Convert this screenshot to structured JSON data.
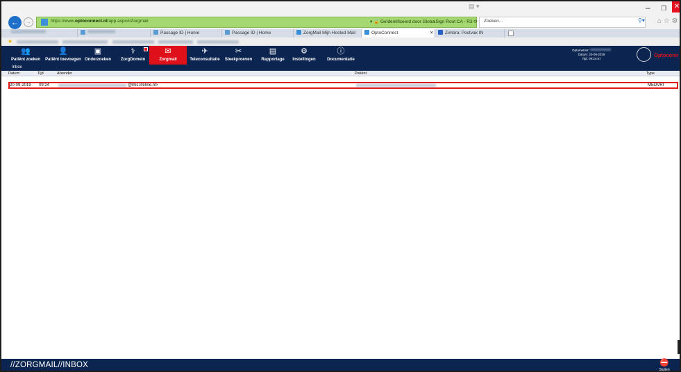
{
  "browser": {
    "window_controls": {
      "minimize": "–",
      "maximize": "❐",
      "close": "✕"
    },
    "address_bar": {
      "url_prefix": "https://www.",
      "url_host": "optoconnect.nl",
      "url_path": "/app.aspx#/Zorgmail",
      "cert_text": "▾ 🔒 Geïdentificeerd door GlobalSign Root CA - R3 ⟳"
    },
    "search": {
      "placeholder": "Zoeken..."
    },
    "tabs": [
      {
        "label": "Passage ID | Home",
        "icon_color": "#5a9bd4"
      },
      {
        "label": "Passage ID | Home",
        "icon_color": "#5a9bd4"
      },
      {
        "label": "ZorgMail Mijn Hosted Mail",
        "icon_color": "#3a8fd9"
      },
      {
        "label": "OptoConnect",
        "icon_color": "#3a8fd9",
        "active": true
      },
      {
        "label": "Zimbra: Postvak IN",
        "icon_color": "#2560c4"
      }
    ],
    "tab_close": "✕"
  },
  "app": {
    "nav": [
      {
        "label": "Patiënt zoeken",
        "icon": "patient-search-icon"
      },
      {
        "label": "Patiënt toevoegen",
        "icon": "patient-add-icon"
      },
      {
        "label": "Onderzoeken",
        "icon": "exam-icon"
      },
      {
        "label": "ZorgDomein",
        "icon": "zorgdomein-icon"
      },
      {
        "label": "Zorgmail",
        "icon": "zorgmail-icon",
        "active": true
      },
      {
        "label": "Teleconsultatie",
        "icon": "teleconsult-icon"
      },
      {
        "label": "Steekproeven",
        "icon": "sample-icon"
      },
      {
        "label": "Rapportage",
        "icon": "report-icon"
      },
      {
        "label": "Instellingen",
        "icon": "settings-icon"
      },
      {
        "label": "Documentatie",
        "icon": "help-icon"
      }
    ],
    "user_info": {
      "line1": "Optometrist:",
      "line2": "Datum: 20-09-2019",
      "line3": "Tijd: 09:24:57"
    },
    "logo_text": "Optoconn",
    "section_title": "Inbox",
    "table": {
      "columns": [
        "Datum",
        "Tijd",
        "Afzender",
        "Patiënt",
        "Type"
      ],
      "rows": [
        {
          "datum": "20-09-2019",
          "tijd": "09:24",
          "afzender": "@lms.lifeline.nl>",
          "patient": "",
          "type": "MEDVRI"
        }
      ]
    },
    "footer": {
      "path": "//ZORGMAIL//INBOX",
      "close_label": "Sluiten"
    }
  },
  "colors": {
    "nav_bg": "#0b2550",
    "accent_red": "#e0101a",
    "address_green": "#a5d870"
  }
}
